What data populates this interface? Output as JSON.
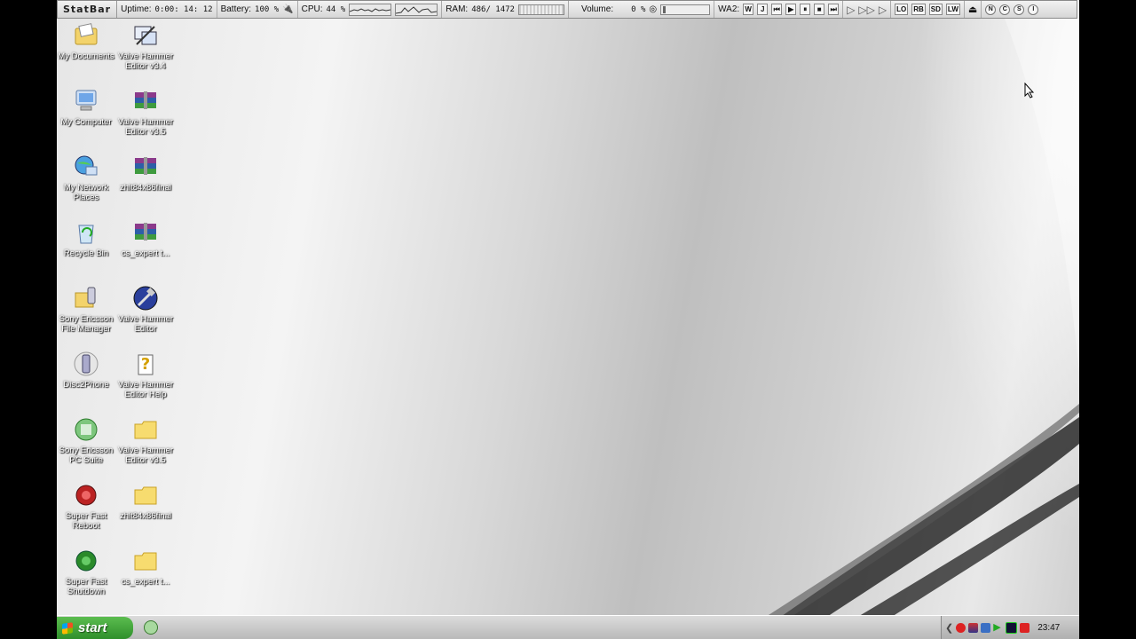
{
  "statbar": {
    "brand": "StatBar",
    "uptime_label": "Uptime:",
    "uptime_value": "0:00: 14: 12",
    "battery_label": "Battery:",
    "battery_value": "100 %",
    "cpu_label": "CPU:",
    "cpu_value": "44 %",
    "ram_label": "RAM:",
    "ram_value": "486/ 1472",
    "volume_label": "Volume:",
    "volume_value": "0 %",
    "wa2_label": "WA2:",
    "wa2_buttons": [
      "W",
      "J"
    ],
    "right_buttons": [
      "LO",
      "RB",
      "SD",
      "LW"
    ],
    "circle_buttons": [
      "N",
      "C",
      "S",
      "I"
    ]
  },
  "desktop_icons": [
    {
      "label": "My Documents",
      "icon": "my-documents-icon"
    },
    {
      "label": "Valve Hammer Editor v3.4",
      "icon": "hammer-editor-icon"
    },
    {
      "label": "My Computer",
      "icon": "my-computer-icon"
    },
    {
      "label": "Valve Hammer Editor v3.5",
      "icon": "rar-archive-icon"
    },
    {
      "label": "My Network Places",
      "icon": "network-places-icon"
    },
    {
      "label": "zhlt84x86final",
      "icon": "rar-archive-icon"
    },
    {
      "label": "Recycle Bin",
      "icon": "recycle-bin-icon"
    },
    {
      "label": "cs_expert t...",
      "icon": "rar-archive-icon"
    },
    {
      "label": "Sony Ericsson File Manager",
      "icon": "file-manager-icon"
    },
    {
      "label": "Valve Hammer Editor",
      "icon": "hammer-icon"
    },
    {
      "label": "Disc2Phone",
      "icon": "disc2phone-icon"
    },
    {
      "label": "Valve Hammer Editor Help",
      "icon": "help-icon"
    },
    {
      "label": "Sony Ericsson PC Suite",
      "icon": "pc-suite-icon"
    },
    {
      "label": "Valve Hammer Editor v3.5",
      "icon": "folder-icon"
    },
    {
      "label": "Super Fast Reboot",
      "icon": "reboot-icon"
    },
    {
      "label": "zhlt84x86final",
      "icon": "folder-icon"
    },
    {
      "label": "Super Fast Shutdown",
      "icon": "shutdown-icon"
    },
    {
      "label": "cs_expert t...",
      "icon": "folder-icon"
    }
  ],
  "taskbar": {
    "start_label": "start",
    "clock": "23:47"
  }
}
